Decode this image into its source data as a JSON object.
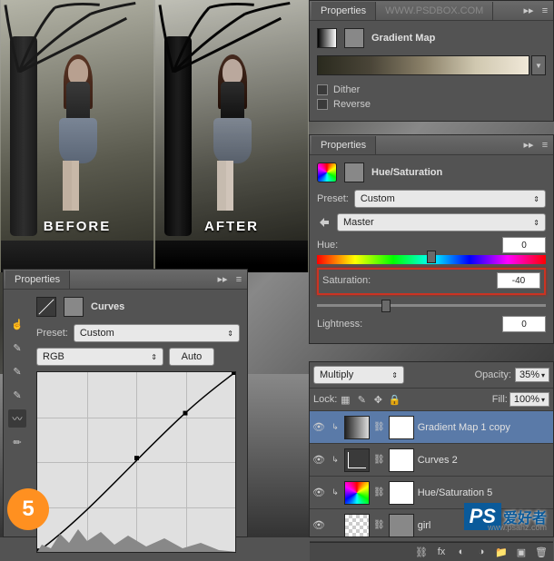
{
  "preview": {
    "before_label": "BEFORE",
    "after_label": "AFTER"
  },
  "gradient_map_panel": {
    "tab": "Properties",
    "url_tab": "WWW.PSDBOX.COM",
    "title": "Gradient Map",
    "dither_label": "Dither",
    "reverse_label": "Reverse"
  },
  "hue_sat_panel": {
    "tab": "Properties",
    "title": "Hue/Saturation",
    "preset_label": "Preset:",
    "preset_value": "Custom",
    "channel_value": "Master",
    "hue_label": "Hue:",
    "hue_value": "0",
    "saturation_label": "Saturation:",
    "saturation_value": "-40",
    "lightness_label": "Lightness:",
    "lightness_value": "0"
  },
  "layers": {
    "blend_mode": "Multiply",
    "opacity_label": "Opacity:",
    "opacity_value": "35%",
    "lock_label": "Lock:",
    "fill_label": "Fill:",
    "fill_value": "100%",
    "items": [
      {
        "name": "Gradient Map 1 copy"
      },
      {
        "name": "Curves 2"
      },
      {
        "name": "Hue/Saturation 5"
      },
      {
        "name": "girl"
      }
    ]
  },
  "curves_panel": {
    "tab": "Properties",
    "title": "Curves",
    "preset_label": "Preset:",
    "preset_value": "Custom",
    "channel_value": "RGB",
    "auto_label": "Auto"
  },
  "step": "5",
  "watermark": {
    "ps": "PS",
    "cn": "爱好者",
    "url": "www.psahz.com"
  }
}
